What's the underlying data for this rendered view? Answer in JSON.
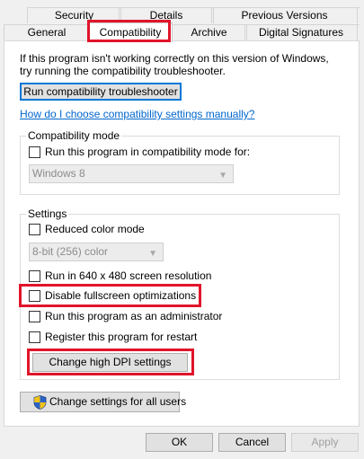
{
  "tabs": {
    "row1": [
      "Security",
      "Details",
      "Previous Versions"
    ],
    "row2": [
      "General",
      "Compatibility",
      "Archive",
      "Digital Signatures"
    ],
    "active": "Compatibility"
  },
  "intro": {
    "line1": "If this program isn't working correctly on this version of Windows,",
    "line2": "try running the compatibility troubleshooter."
  },
  "troubleshooter_button": "Run compatibility troubleshooter",
  "help_link": "How do I choose compatibility settings manually?",
  "compat_mode": {
    "legend": "Compatibility mode",
    "checkbox_label": "Run this program in compatibility mode for:",
    "checked": false,
    "select_value": "Windows 8"
  },
  "settings": {
    "legend": "Settings",
    "reduced_color_label": "Reduced color mode",
    "color_select_value": "8-bit (256) color",
    "res_640_label": "Run in 640 x 480 screen resolution",
    "fullscreen_opt_label": "Disable fullscreen optimizations",
    "admin_label": "Run this program as an administrator",
    "restart_label": "Register this program for restart",
    "dpi_button": "Change high DPI settings"
  },
  "all_users_button": "Change settings for all users",
  "footer": {
    "ok": "OK",
    "cancel": "Cancel",
    "apply": "Apply"
  },
  "colors": {
    "highlight": "#e0152a",
    "link": "#0066cc",
    "focus": "#0078d7"
  },
  "icons": [
    "shield-icon"
  ]
}
